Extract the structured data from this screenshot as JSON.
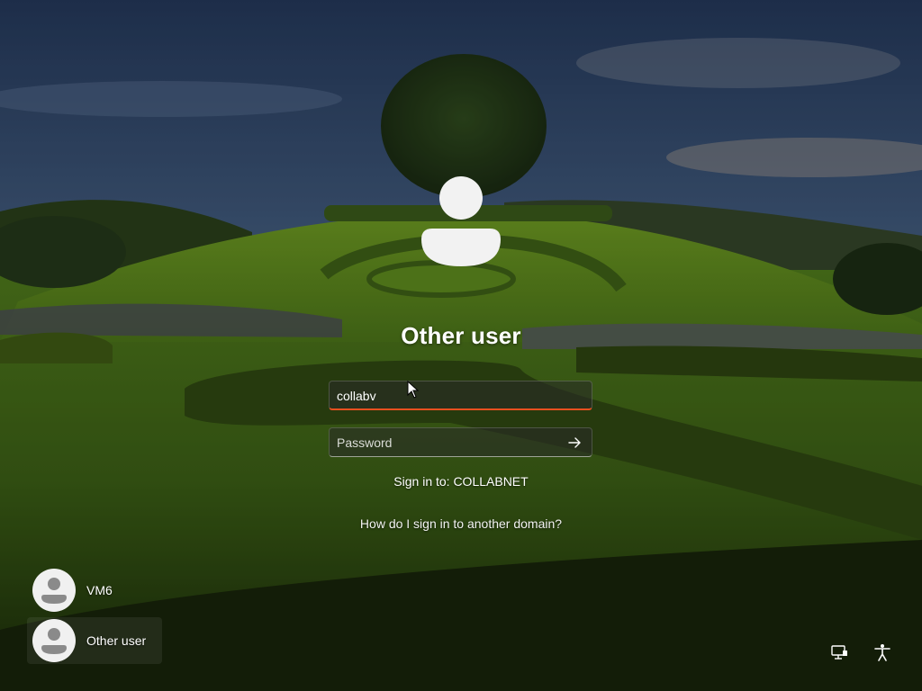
{
  "login": {
    "user_title": "Other user",
    "username_value": "collabv",
    "password_placeholder": "Password",
    "sign_in_to": "Sign in to: COLLABNET",
    "domain_help_link": "How do I sign in to another domain?"
  },
  "user_list": [
    {
      "name": "VM6"
    },
    {
      "name": "Other user"
    }
  ],
  "corner_icons": [
    "network-icon",
    "accessibility-icon"
  ],
  "colors": {
    "focus_underline": "#e8501f",
    "field_background": "rgba(40,40,40,0.55)"
  }
}
